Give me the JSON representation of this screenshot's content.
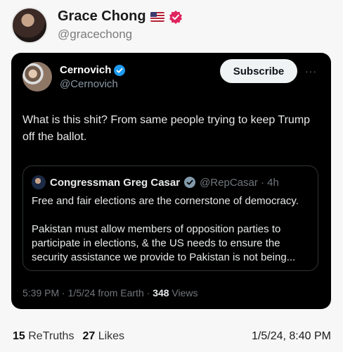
{
  "profile": {
    "display_name": "Grace Chong",
    "handle": "@gracechong"
  },
  "embedded_post": {
    "author_name": "Cernovich",
    "author_handle": "@Cernovich",
    "subscribe_label": "Subscribe",
    "more_label": "···",
    "text": "What is this shit? From same people trying to keep Trump off the ballot.",
    "quote": {
      "name": "Congressman Greg Casar",
      "handle_time": "@RepCasar · 4h",
      "paragraph1": "Free and fair elections are the cornerstone of democracy.",
      "paragraph2": "Pakistan must allow members of opposition parties to participate in elections, & the US needs to ensure the security assistance we provide to Pakistan is not being..."
    },
    "meta": {
      "time_source": "5:39 PM · 1/5/24 from Earth · ",
      "views_count": "348",
      "views_label": " Views"
    }
  },
  "footer": {
    "retruths_count": "15",
    "retruths_label": "ReTruths",
    "likes_count": "27",
    "likes_label": "Likes",
    "date": "1/5/24, 8:40 PM"
  },
  "colors": {
    "verified": "#1d9bf0",
    "truth_badge": "#e0245e",
    "card_bg": "#000000",
    "page_bg": "#f7f7f7"
  }
}
